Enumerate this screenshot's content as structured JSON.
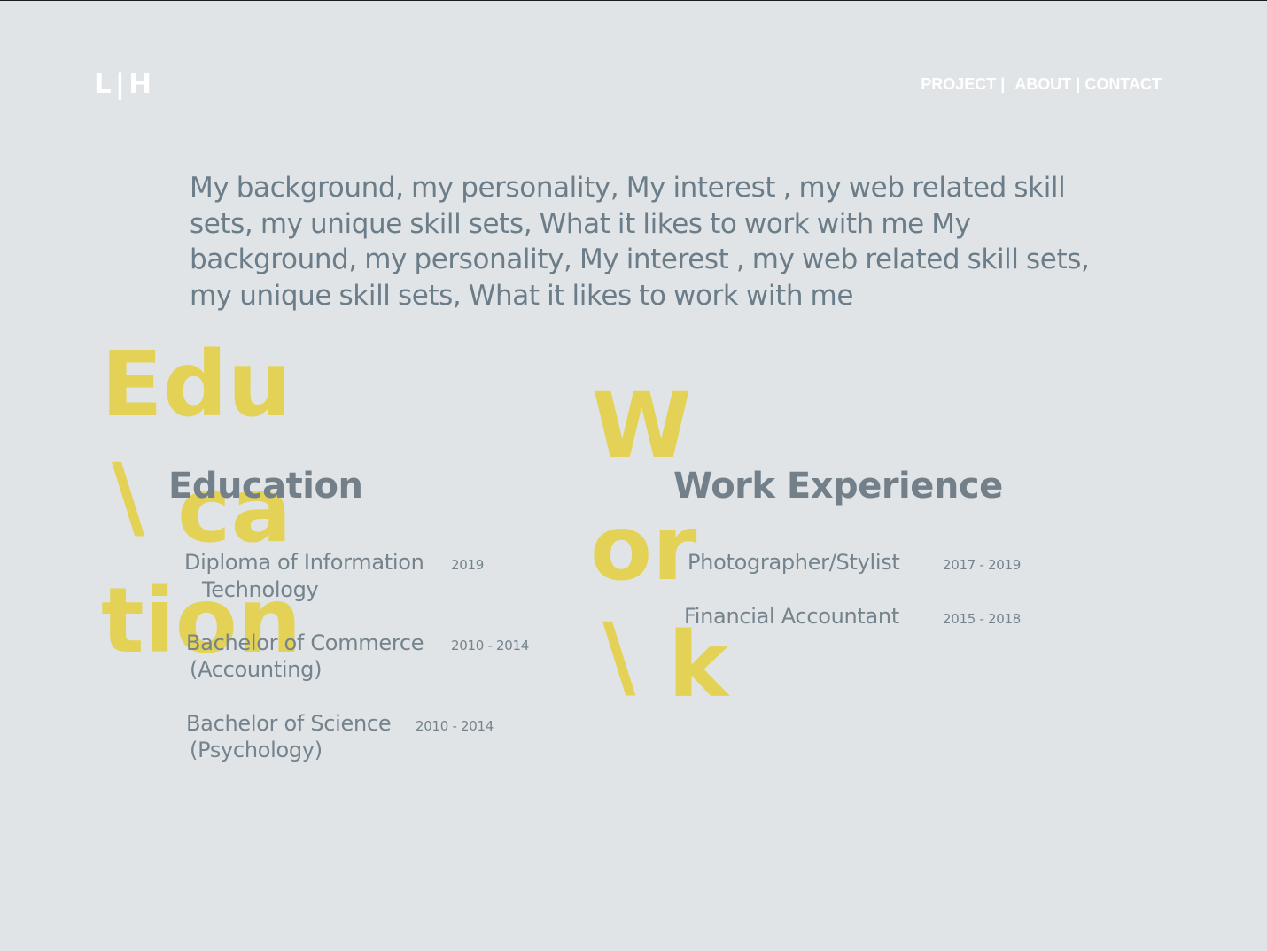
{
  "header": {
    "logo": "L|H",
    "nav": {
      "project": "PROJECT |",
      "about": "ABOUT |",
      "contact": "CONTACT"
    }
  },
  "intro": "My background, my personality, My interest , my web related skill sets, my unique skill sets, What it likes to work with me My background, my personality, My interest , my web related skill sets, my unique skill sets, What it likes to work with me",
  "education": {
    "deco": [
      "Edu",
      "\\",
      "ca",
      "tion"
    ],
    "title": "Education",
    "items": [
      {
        "line1": "Diploma of Information",
        "line2": "Technology",
        "year": "2019"
      },
      {
        "line1": "Bachelor of Commerce",
        "line2": "(Accounting)",
        "year": "2010 - 2014"
      },
      {
        "line1": "Bachelor of Science",
        "line2": "(Psychology)",
        "year": "2010 - 2014"
      }
    ]
  },
  "work": {
    "deco": [
      "W",
      "or",
      "\\",
      "k"
    ],
    "title": "Work Experience",
    "items": [
      {
        "role": "Photographer/Stylist",
        "year": "2017 - 2019"
      },
      {
        "role": "Financial Accountant",
        "year": "2015 - 2018"
      }
    ]
  },
  "colors": {
    "background": "#e0e4e7",
    "accent_yellow": "#e3d255",
    "text_slate": "#6b7d89",
    "nav_white": "#ffffff"
  }
}
